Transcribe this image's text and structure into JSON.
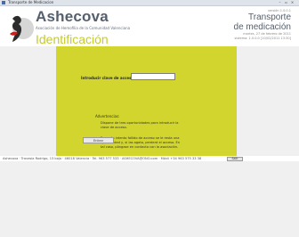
{
  "window": {
    "title": "Transporte de Medicacion"
  },
  "header": {
    "brand_name": "Ashecova",
    "brand_sub": "Asociación de Hemofilia de la Comunidad Valenciana",
    "section": "Identificación",
    "right_small": "versión 1.0.0.1",
    "right_title_1": "Transporte",
    "right_title_2": "de medicación",
    "right_line_1": "martes, 27 de febrero de 2011",
    "right_line_2": "sistema: 1.0.0.0 [10/02/2011 13:30]"
  },
  "login": {
    "label": "Introducir clave de acceso",
    "value": ""
  },
  "advertencias": {
    "title": "Advertencias:",
    "text1": "Dispone de tres oportunidades para introducir la clave de acceso.",
    "text2": "Por cada intento fallido de acceso se le resta una oportunidad y, si las agota, perderá el acceso. En tal caso, póngase en contacto con la asociación."
  },
  "button": {
    "entrar": "Entrar"
  },
  "footer": {
    "text": "Ashecova · Travesía Rodrigo, 13 bajo · 46018 Valencia · Tel. 963 577 533 · ASHECOVA@ONO.com · Móvil +34 963 575 33 38",
    "button": "Salir"
  }
}
